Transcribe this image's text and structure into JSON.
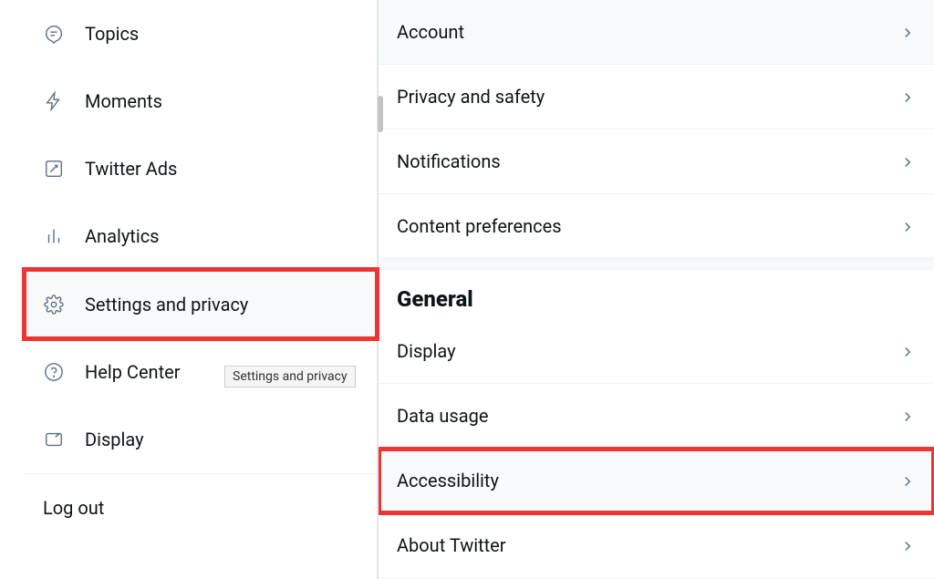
{
  "sidebar": {
    "items": [
      {
        "label": "Topics",
        "icon": "topics-icon"
      },
      {
        "label": "Moments",
        "icon": "moments-icon"
      },
      {
        "label": "Twitter Ads",
        "icon": "ads-icon"
      },
      {
        "label": "Analytics",
        "icon": "analytics-icon"
      },
      {
        "label": "Settings and privacy",
        "icon": "gear-icon",
        "selected": true
      },
      {
        "label": "Help Center",
        "icon": "help-icon"
      },
      {
        "label": "Display",
        "icon": "display-icon"
      },
      {
        "label": "Log out"
      }
    ]
  },
  "tooltip": "Settings and privacy",
  "settings": {
    "top_items": [
      {
        "label": "Account",
        "selected": true
      },
      {
        "label": "Privacy and safety"
      },
      {
        "label": "Notifications"
      },
      {
        "label": "Content preferences"
      }
    ],
    "general_header": "General",
    "general_items": [
      {
        "label": "Display"
      },
      {
        "label": "Data usage"
      },
      {
        "label": "Accessibility",
        "highlighted": true
      },
      {
        "label": "About Twitter"
      }
    ]
  }
}
